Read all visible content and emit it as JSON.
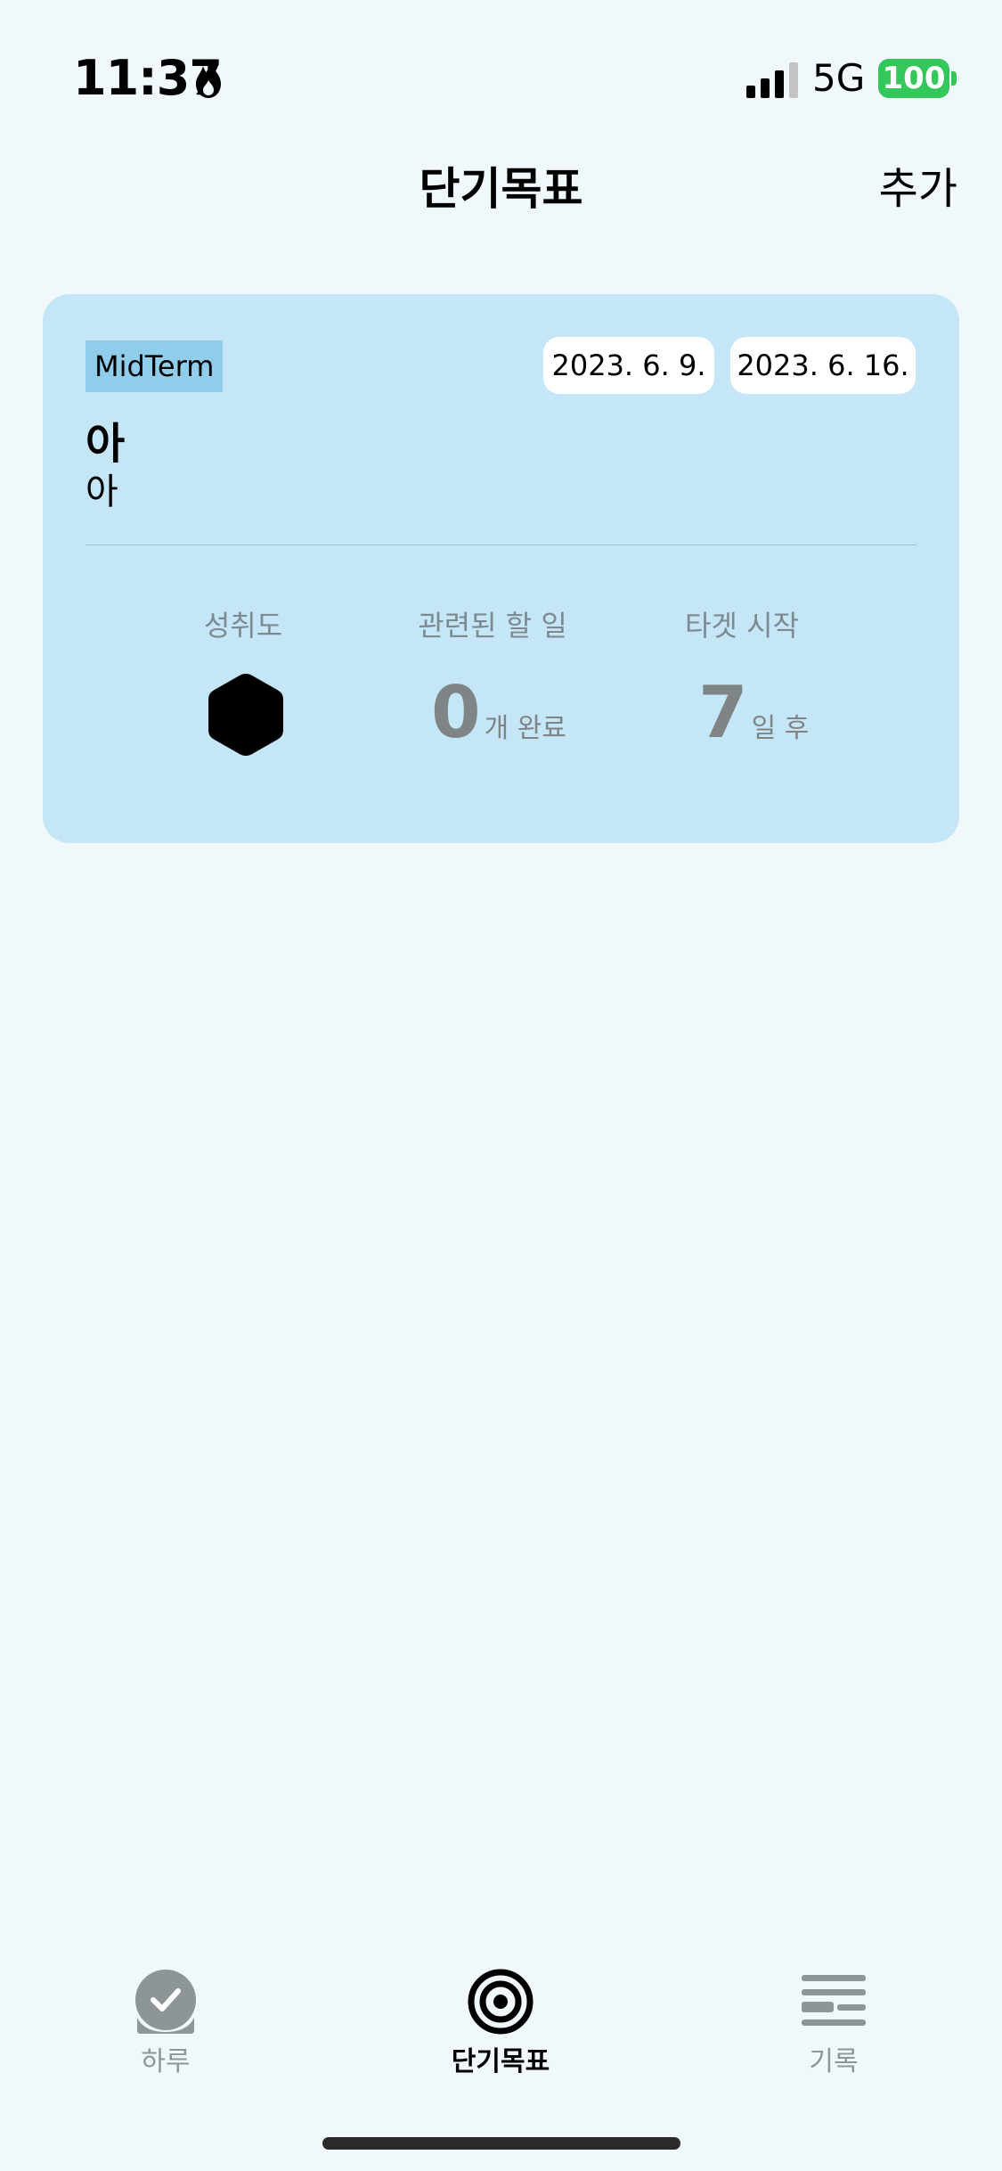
{
  "status_bar": {
    "time": "11:37",
    "network": "5G",
    "battery": "100",
    "icons": [
      "flame-icon",
      "signal-icon",
      "battery-icon"
    ]
  },
  "nav": {
    "title": "단기목표",
    "add_label": "추가"
  },
  "goal": {
    "category": "MidTerm",
    "start_date": "2023. 6. 9.",
    "end_date": "2023. 6. 16.",
    "title": "아",
    "description": "아",
    "stats": {
      "achievement_label": "성취도",
      "achievement_icon": "hexagon-icon",
      "related_label": "관련된 할 일",
      "related_value": "0",
      "related_unit": "개 완료",
      "target_label": "타겟 시작",
      "target_value": "7",
      "target_unit": "일 후"
    }
  },
  "tabs": [
    {
      "label": "하루",
      "icon": "check-circle-icon",
      "active": false
    },
    {
      "label": "단기목표",
      "icon": "target-icon",
      "active": true
    },
    {
      "label": "기록",
      "icon": "list-lines-icon",
      "active": false
    }
  ],
  "colors": {
    "background": "#f0f8fc",
    "card": "#c5e6f6",
    "tag": "#8fcdea",
    "battery": "#34c759",
    "muted": "#7f8487"
  }
}
